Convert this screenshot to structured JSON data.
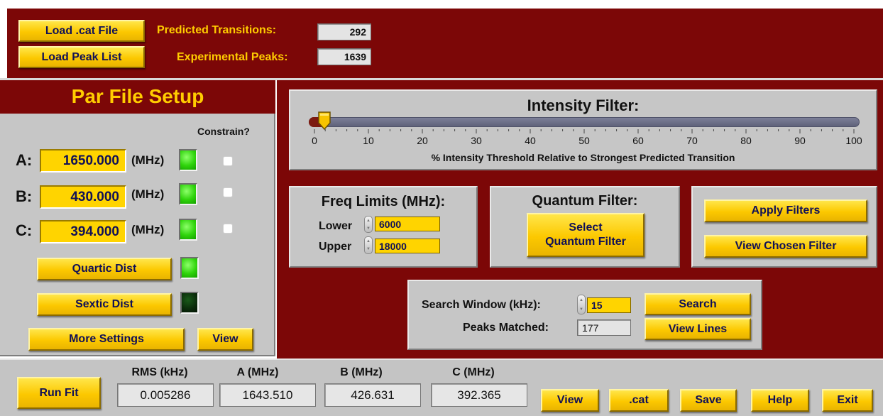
{
  "top_bar": {
    "load_cat_label": "Load .cat File",
    "load_peak_label": "Load Peak List",
    "predicted_label": "Predicted Transitions:",
    "predicted_value": "292",
    "experimental_label": "Experimental Peaks:",
    "experimental_value": "1639"
  },
  "par_setup": {
    "title": "Par File Setup",
    "constrain_label": "Constrain?",
    "params": [
      {
        "name": "A:",
        "value": "1650.000",
        "unit": "(MHz)",
        "led": "on",
        "constrained": false
      },
      {
        "name": "B:",
        "value": "430.000",
        "unit": "(MHz)",
        "led": "on",
        "constrained": false
      },
      {
        "name": "C:",
        "value": "394.000",
        "unit": "(MHz)",
        "led": "on",
        "constrained": false
      }
    ],
    "quartic_label": "Quartic Dist",
    "quartic_led": "on",
    "sextic_label": "Sextic Dist",
    "sextic_led": "off",
    "more_settings_label": "More Settings",
    "view_label": "View"
  },
  "intensity_filter": {
    "title": "Intensity Filter:",
    "value": 1,
    "ticks": [
      "0",
      "10",
      "20",
      "30",
      "40",
      "50",
      "60",
      "70",
      "80",
      "90",
      "100"
    ],
    "caption": "% Intensity Threshold Relative to Strongest Predicted Transition"
  },
  "freq_limits": {
    "title": "Freq Limits (MHz):",
    "lower_label": "Lower",
    "lower_value": "6000",
    "upper_label": "Upper",
    "upper_value": "18000"
  },
  "quantum_filter": {
    "title": "Quantum Filter:",
    "select_label_line1": "Select",
    "select_label_line2": "Quantum Filter"
  },
  "filter_actions": {
    "apply_label": "Apply Filters",
    "view_chosen_label": "View Chosen Filter"
  },
  "search": {
    "window_label": "Search Window (kHz):",
    "window_value": "15",
    "matched_label": "Peaks Matched:",
    "matched_value": "177",
    "search_label": "Search",
    "view_lines_label": "View Lines"
  },
  "bottom_bar": {
    "run_fit_label": "Run Fit",
    "rms_header": "RMS (kHz)",
    "rms_value": "0.005286",
    "a_header": "A (MHz)",
    "a_value": "1643.510",
    "b_header": "B (MHz)",
    "b_value": "426.631",
    "c_header": "C (MHz)",
    "c_value": "392.365",
    "view_label": "View",
    "cat_label": ".cat",
    "save_label": "Save",
    "help_label": "Help",
    "exit_label": "Exit"
  },
  "colors": {
    "maroon": "#7c0707",
    "panel_gray": "#c6c6c6",
    "button_yellow": "#fcc800",
    "label_yellow": "#ffcc00",
    "button_text": "#101057",
    "led_green": "#2fd40b"
  }
}
